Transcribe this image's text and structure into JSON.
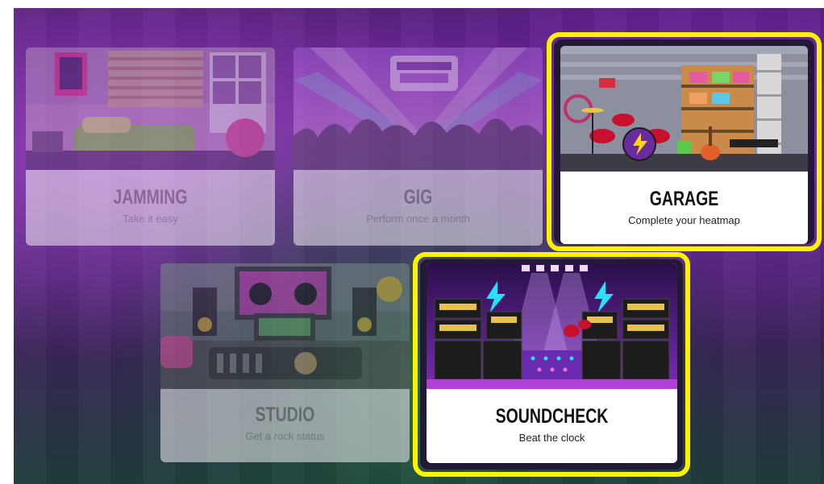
{
  "modes": [
    {
      "id": "jamming",
      "title": "JAMMING",
      "subtitle": "Take it easy",
      "state": "disabled"
    },
    {
      "id": "gig",
      "title": "GIG",
      "subtitle": "Perform once a month",
      "state": "disabled"
    },
    {
      "id": "garage",
      "title": "GARAGE",
      "subtitle": "Complete your heatmap",
      "state": "highlighted"
    },
    {
      "id": "studio",
      "title": "STUDIO",
      "subtitle": "Get a rock status",
      "state": "disabled"
    },
    {
      "id": "soundcheck",
      "title": "SOUNDCHECK",
      "subtitle": "Beat the clock",
      "state": "highlighted"
    }
  ],
  "colors": {
    "highlight": "#fff200",
    "background": "#4e1c74"
  }
}
